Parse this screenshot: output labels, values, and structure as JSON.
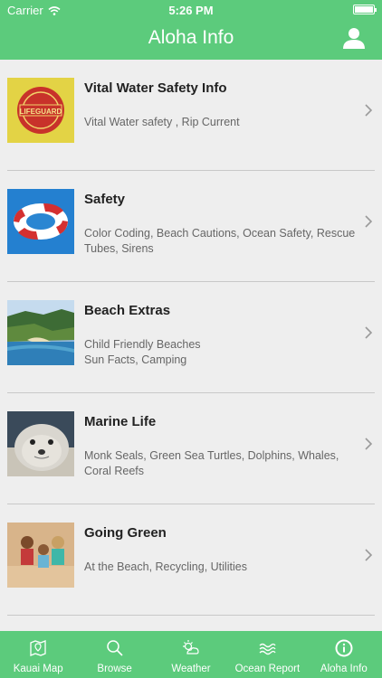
{
  "status_bar": {
    "carrier": "Carrier",
    "time": "5:26 PM"
  },
  "nav": {
    "title": "Aloha Info"
  },
  "items": [
    {
      "title": "Vital Water Safety Info",
      "subtitle": "Vital Water safety , Rip Current",
      "image": "lifeguard-shirt"
    },
    {
      "title": "Safety",
      "subtitle": "Color Coding, Beach Cautions, Ocean Safety, Rescue Tubes, Sirens",
      "image": "life-ring"
    },
    {
      "title": "Beach Extras",
      "subtitle": "Child Friendly Beaches\nSun Facts, Camping",
      "image": "coastline"
    },
    {
      "title": "Marine Life",
      "subtitle": "Monk Seals, Green Sea Turtles, Dolphins, Whales, Coral Reefs",
      "image": "monk-seal"
    },
    {
      "title": "Going Green",
      "subtitle": "At the Beach, Recycling, Utilities",
      "image": "kids-on-beach"
    }
  ],
  "tabs": [
    {
      "label": "Kauai Map",
      "icon": "map-icon"
    },
    {
      "label": "Browse",
      "icon": "search-icon"
    },
    {
      "label": "Weather",
      "icon": "weather-icon"
    },
    {
      "label": "Ocean Report",
      "icon": "waves-icon"
    },
    {
      "label": "Aloha Info",
      "icon": "info-icon",
      "active": true
    }
  ],
  "colors": {
    "brand": "#5ccb7c",
    "list_bg": "#eeeeee"
  }
}
